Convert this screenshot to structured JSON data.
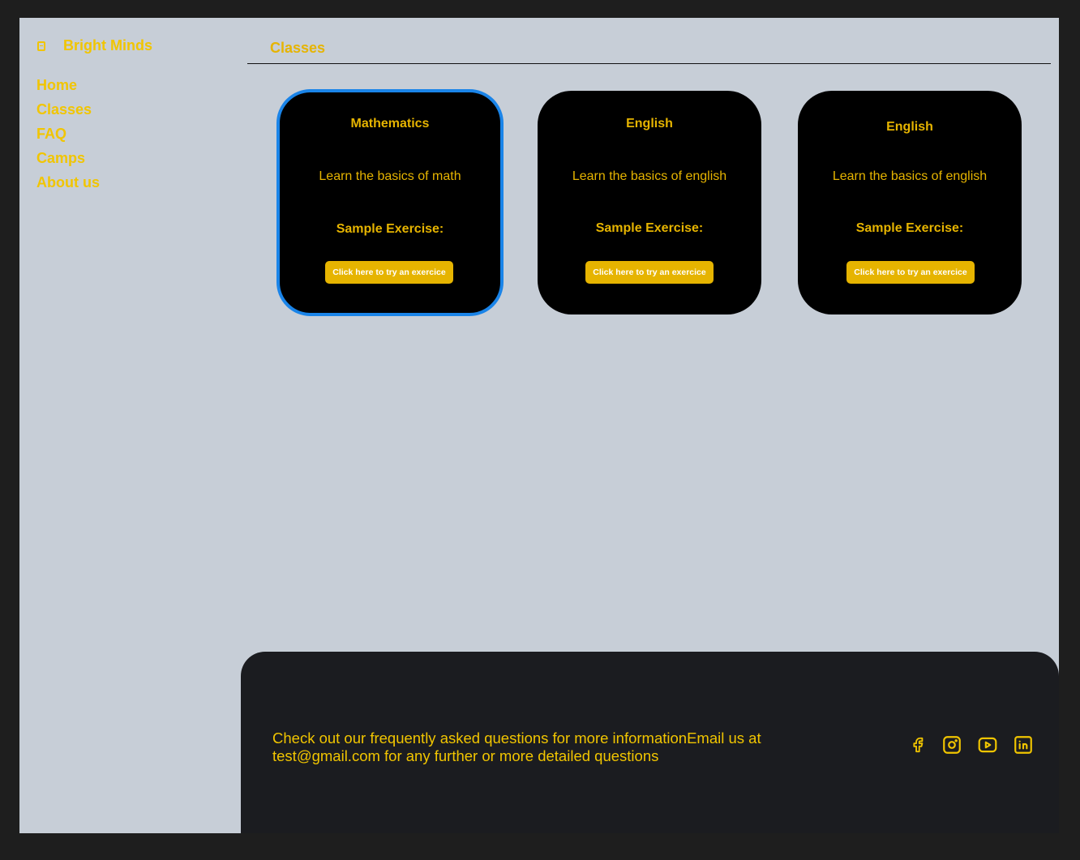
{
  "sidebar": {
    "brand": "Bright Minds",
    "nav": [
      "Home",
      "Classes",
      "FAQ",
      "Camps",
      "About us"
    ]
  },
  "header": {
    "title": "Classes"
  },
  "cards": [
    {
      "title": "Mathematics",
      "description": "Learn the basics of math",
      "subtitle": "Sample Exercise:",
      "button": "Click here to try an exercice"
    },
    {
      "title": "English",
      "description": "Learn the basics of english",
      "subtitle": "Sample Exercise:",
      "button": "Click here to try an exercice"
    },
    {
      "title": "English",
      "description": "Learn the basics of english",
      "subtitle": "Sample Exercise:",
      "button": "Click here to try an exercice"
    }
  ],
  "footer": {
    "text": "Check out our frequently asked questions for more informationEmail us at test@gmail.com for any further or more detailed questions",
    "social_icons": [
      "facebook-icon",
      "instagram-icon",
      "youtube-icon",
      "linkedin-icon"
    ]
  },
  "colors": {
    "accent": "#f1c500",
    "card_bg": "#000000",
    "page_bg": "#c7ced7",
    "footer_bg": "#1b1c20",
    "selection": "#1a84e8"
  }
}
